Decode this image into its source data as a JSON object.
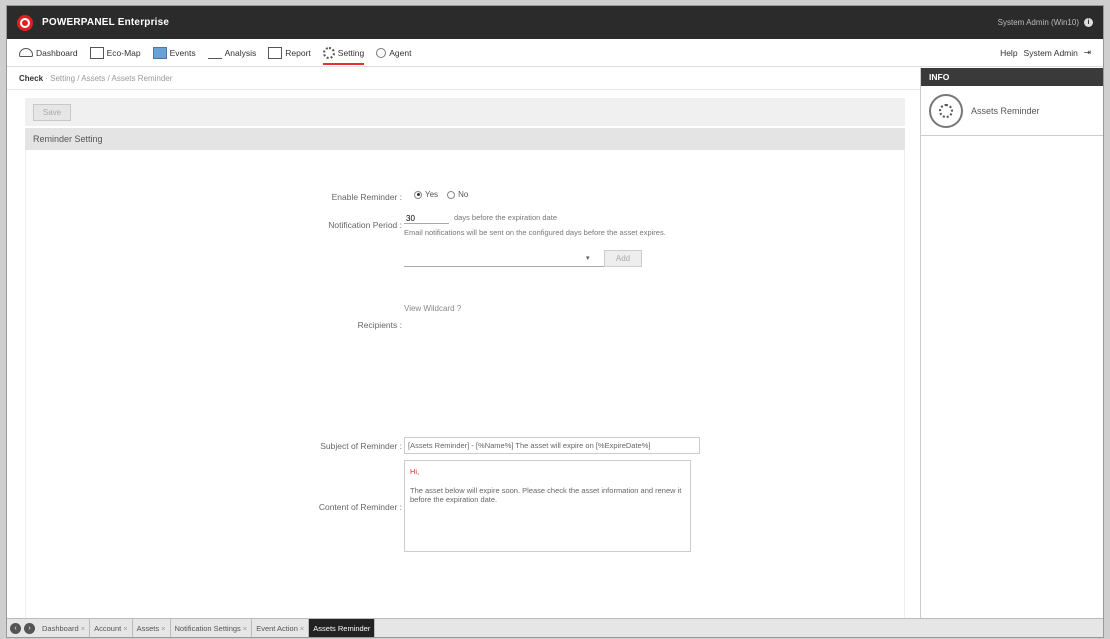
{
  "app": {
    "title": "POWERPANEL Enterprise",
    "sysinfo": "System  Admin (Win10)",
    "info_glyph": "i"
  },
  "nav": {
    "items": [
      {
        "label": "Dashboard",
        "icon": "dashboard-icon"
      },
      {
        "label": "Eco-Map",
        "icon": "map-icon"
      },
      {
        "label": "Events",
        "icon": "events-icon"
      },
      {
        "label": "Analysis",
        "icon": "analysis-icon"
      },
      {
        "label": "Report",
        "icon": "report-icon"
      },
      {
        "label": "Setting",
        "icon": "gear-icon",
        "active": true
      },
      {
        "label": "Agent",
        "icon": "agent-icon"
      }
    ],
    "right": {
      "help": "Help",
      "user": "System Admin",
      "logout": "⇥"
    }
  },
  "breadcrumb": {
    "current": "Check",
    "trail": " · Setting / Assets / Assets Reminder"
  },
  "toolbar": {
    "save_label": "Save"
  },
  "section": {
    "title": "Reminder Setting"
  },
  "form": {
    "enable_label": "Enable Reminder :",
    "enable_yes": "Yes",
    "enable_no": "No",
    "days_label": "Notification Period :",
    "days_value": "30",
    "days_note": "days before the expiration date",
    "days_help": "Email notifications will be sent on the configured days before the asset expires.",
    "recipients_label": "Recipients :",
    "select_arrow": "▾",
    "add_label": "Add",
    "wildcard_link": "View Wildcard ?",
    "subject_label": "Subject of Reminder :",
    "subject_value": "[Assets Reminder] - [%Name%] The asset will expire on [%ExpireDate%]",
    "content_label": "Content of Reminder :",
    "content_greeting": "Hi,",
    "content_body": "The asset below will expire soon. Please check the asset information and renew it before the expiration date."
  },
  "info": {
    "header": "INFO",
    "item_label": "Assets Reminder"
  },
  "tabs": [
    {
      "label": "Dashboard",
      "active": false
    },
    {
      "label": "Account",
      "active": false
    },
    {
      "label": "Assets",
      "active": false
    },
    {
      "label": "Notification Settings",
      "active": false
    },
    {
      "label": "Event Action",
      "active": false
    },
    {
      "label": "Assets Reminder",
      "active": true
    }
  ],
  "tab_close": "×",
  "tab_nav": {
    "prev": "‹",
    "next": "›"
  }
}
